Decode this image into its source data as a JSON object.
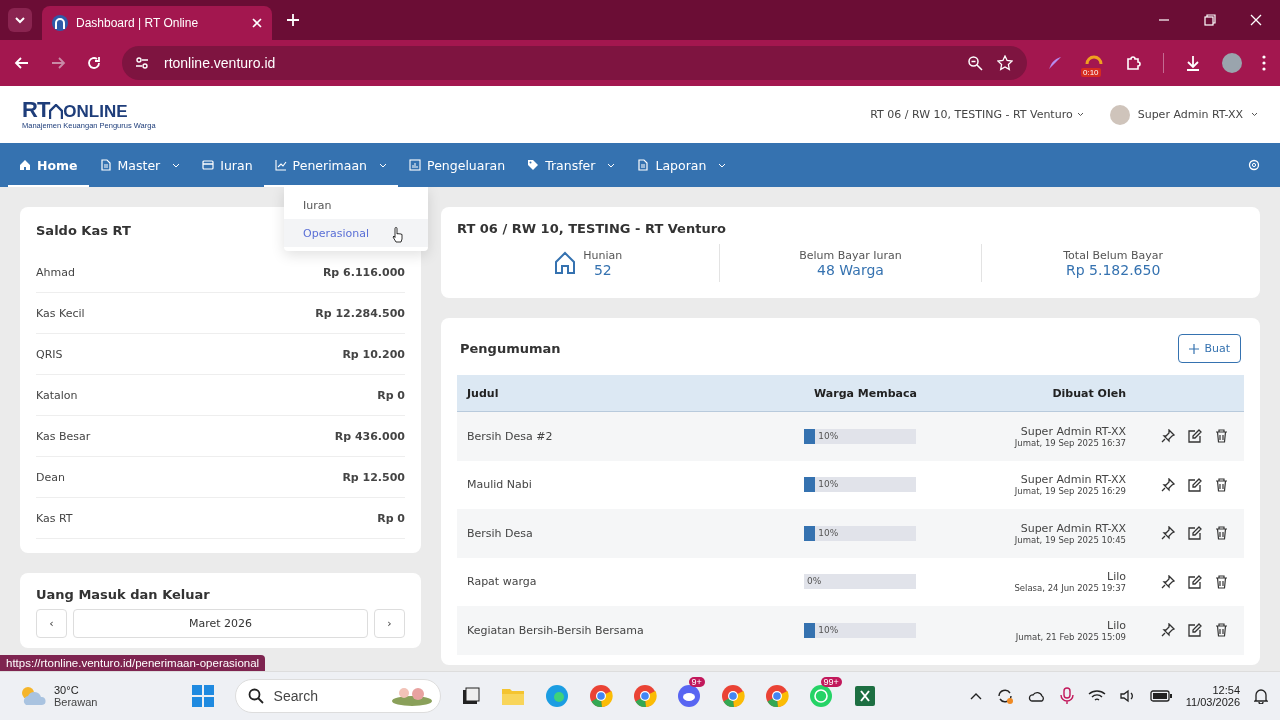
{
  "browser": {
    "tab_title": "Dashboard | RT Online",
    "url": "rtonline.venturo.id",
    "extension_badge": "0:10",
    "status_url": "https://rtonline.venturo.id/penerimaan-operasional"
  },
  "header": {
    "logo_main": "RT",
    "logo_tail": "ONLINE",
    "logo_tagline": "Manajemen Keuangan Pengurus Warga",
    "location": "RT 06 / RW 10, TESTING - RT Venturo",
    "user": "Super Admin RT-XX"
  },
  "nav": [
    {
      "label": "Home",
      "selected": true,
      "caret": false,
      "expanded": false
    },
    {
      "label": "Master",
      "selected": false,
      "caret": true,
      "expanded": false
    },
    {
      "label": "Iuran",
      "selected": false,
      "caret": false,
      "expanded": false
    },
    {
      "label": "Penerimaan",
      "selected": false,
      "caret": true,
      "expanded": true
    },
    {
      "label": "Pengeluaran",
      "selected": false,
      "caret": false,
      "expanded": false
    },
    {
      "label": "Transfer",
      "selected": false,
      "caret": true,
      "expanded": false
    },
    {
      "label": "Laporan",
      "selected": false,
      "caret": true,
      "expanded": false
    }
  ],
  "dropdown": [
    {
      "label": "Iuran",
      "selected": false
    },
    {
      "label": "Operasional",
      "selected": true
    }
  ],
  "saldo": {
    "title": "Saldo Kas RT",
    "rows": [
      {
        "name": "Ahmad",
        "amount": "Rp 6.116.000"
      },
      {
        "name": "Kas Kecil",
        "amount": "Rp 12.284.500"
      },
      {
        "name": "QRIS",
        "amount": "Rp 10.200"
      },
      {
        "name": "Katalon",
        "amount": "Rp 0"
      },
      {
        "name": "Kas Besar",
        "amount": "Rp 436.000"
      },
      {
        "name": "Dean",
        "amount": "Rp 12.500"
      },
      {
        "name": "Kas RT",
        "amount": "Rp 0"
      }
    ]
  },
  "flow": {
    "title": "Uang Masuk dan Keluar",
    "prev": "‹",
    "month": "Maret 2026",
    "next": "›"
  },
  "summary": {
    "title": "RT 06 / RW 10, TESTING - RT Venturo",
    "stats": [
      {
        "label": "Hunian",
        "value": "52"
      },
      {
        "label": "Belum Bayar Iuran",
        "value": "48 Warga"
      },
      {
        "label": "Total Belum Bayar",
        "value": "Rp 5.182.650"
      }
    ]
  },
  "announcements": {
    "title": "Pengumuman",
    "create_button": "Buat",
    "columns": [
      "Judul",
      "Warga Membaca",
      "Dibuat Oleh"
    ],
    "rows": [
      {
        "title": "Bersih Desa #2",
        "level": 0.1,
        "reading": "10%",
        "author": "Super Admin RT-XX",
        "date": "Jumat, 19 Sep 2025 16:37"
      },
      {
        "title": "Maulid Nabi",
        "level": 0.1,
        "reading": "10%",
        "author": "Super Admin RT-XX",
        "date": "Jumat, 19 Sep 2025 16:29"
      },
      {
        "title": "Bersih Desa",
        "level": 0.1,
        "reading": "10%",
        "author": "Super Admin RT-XX",
        "date": "Jumat, 19 Sep 2025 10:45"
      },
      {
        "title": "Rapat warga",
        "level": 0,
        "reading": "0%",
        "author": "Lilo",
        "date": "Selasa, 24 Jun 2025 19:37"
      },
      {
        "title": "Kegiatan Bersih-Bersih Bersama",
        "level": 0.1,
        "reading": "10%",
        "author": "Lilo",
        "date": "Jumat, 21 Feb 2025 15:09"
      }
    ]
  },
  "taskbar": {
    "temperature": "30°C",
    "weather": "Berawan",
    "search": "Search",
    "badges": [
      "9+",
      "99+"
    ],
    "time": "12:54",
    "date": "11/03/2026"
  }
}
